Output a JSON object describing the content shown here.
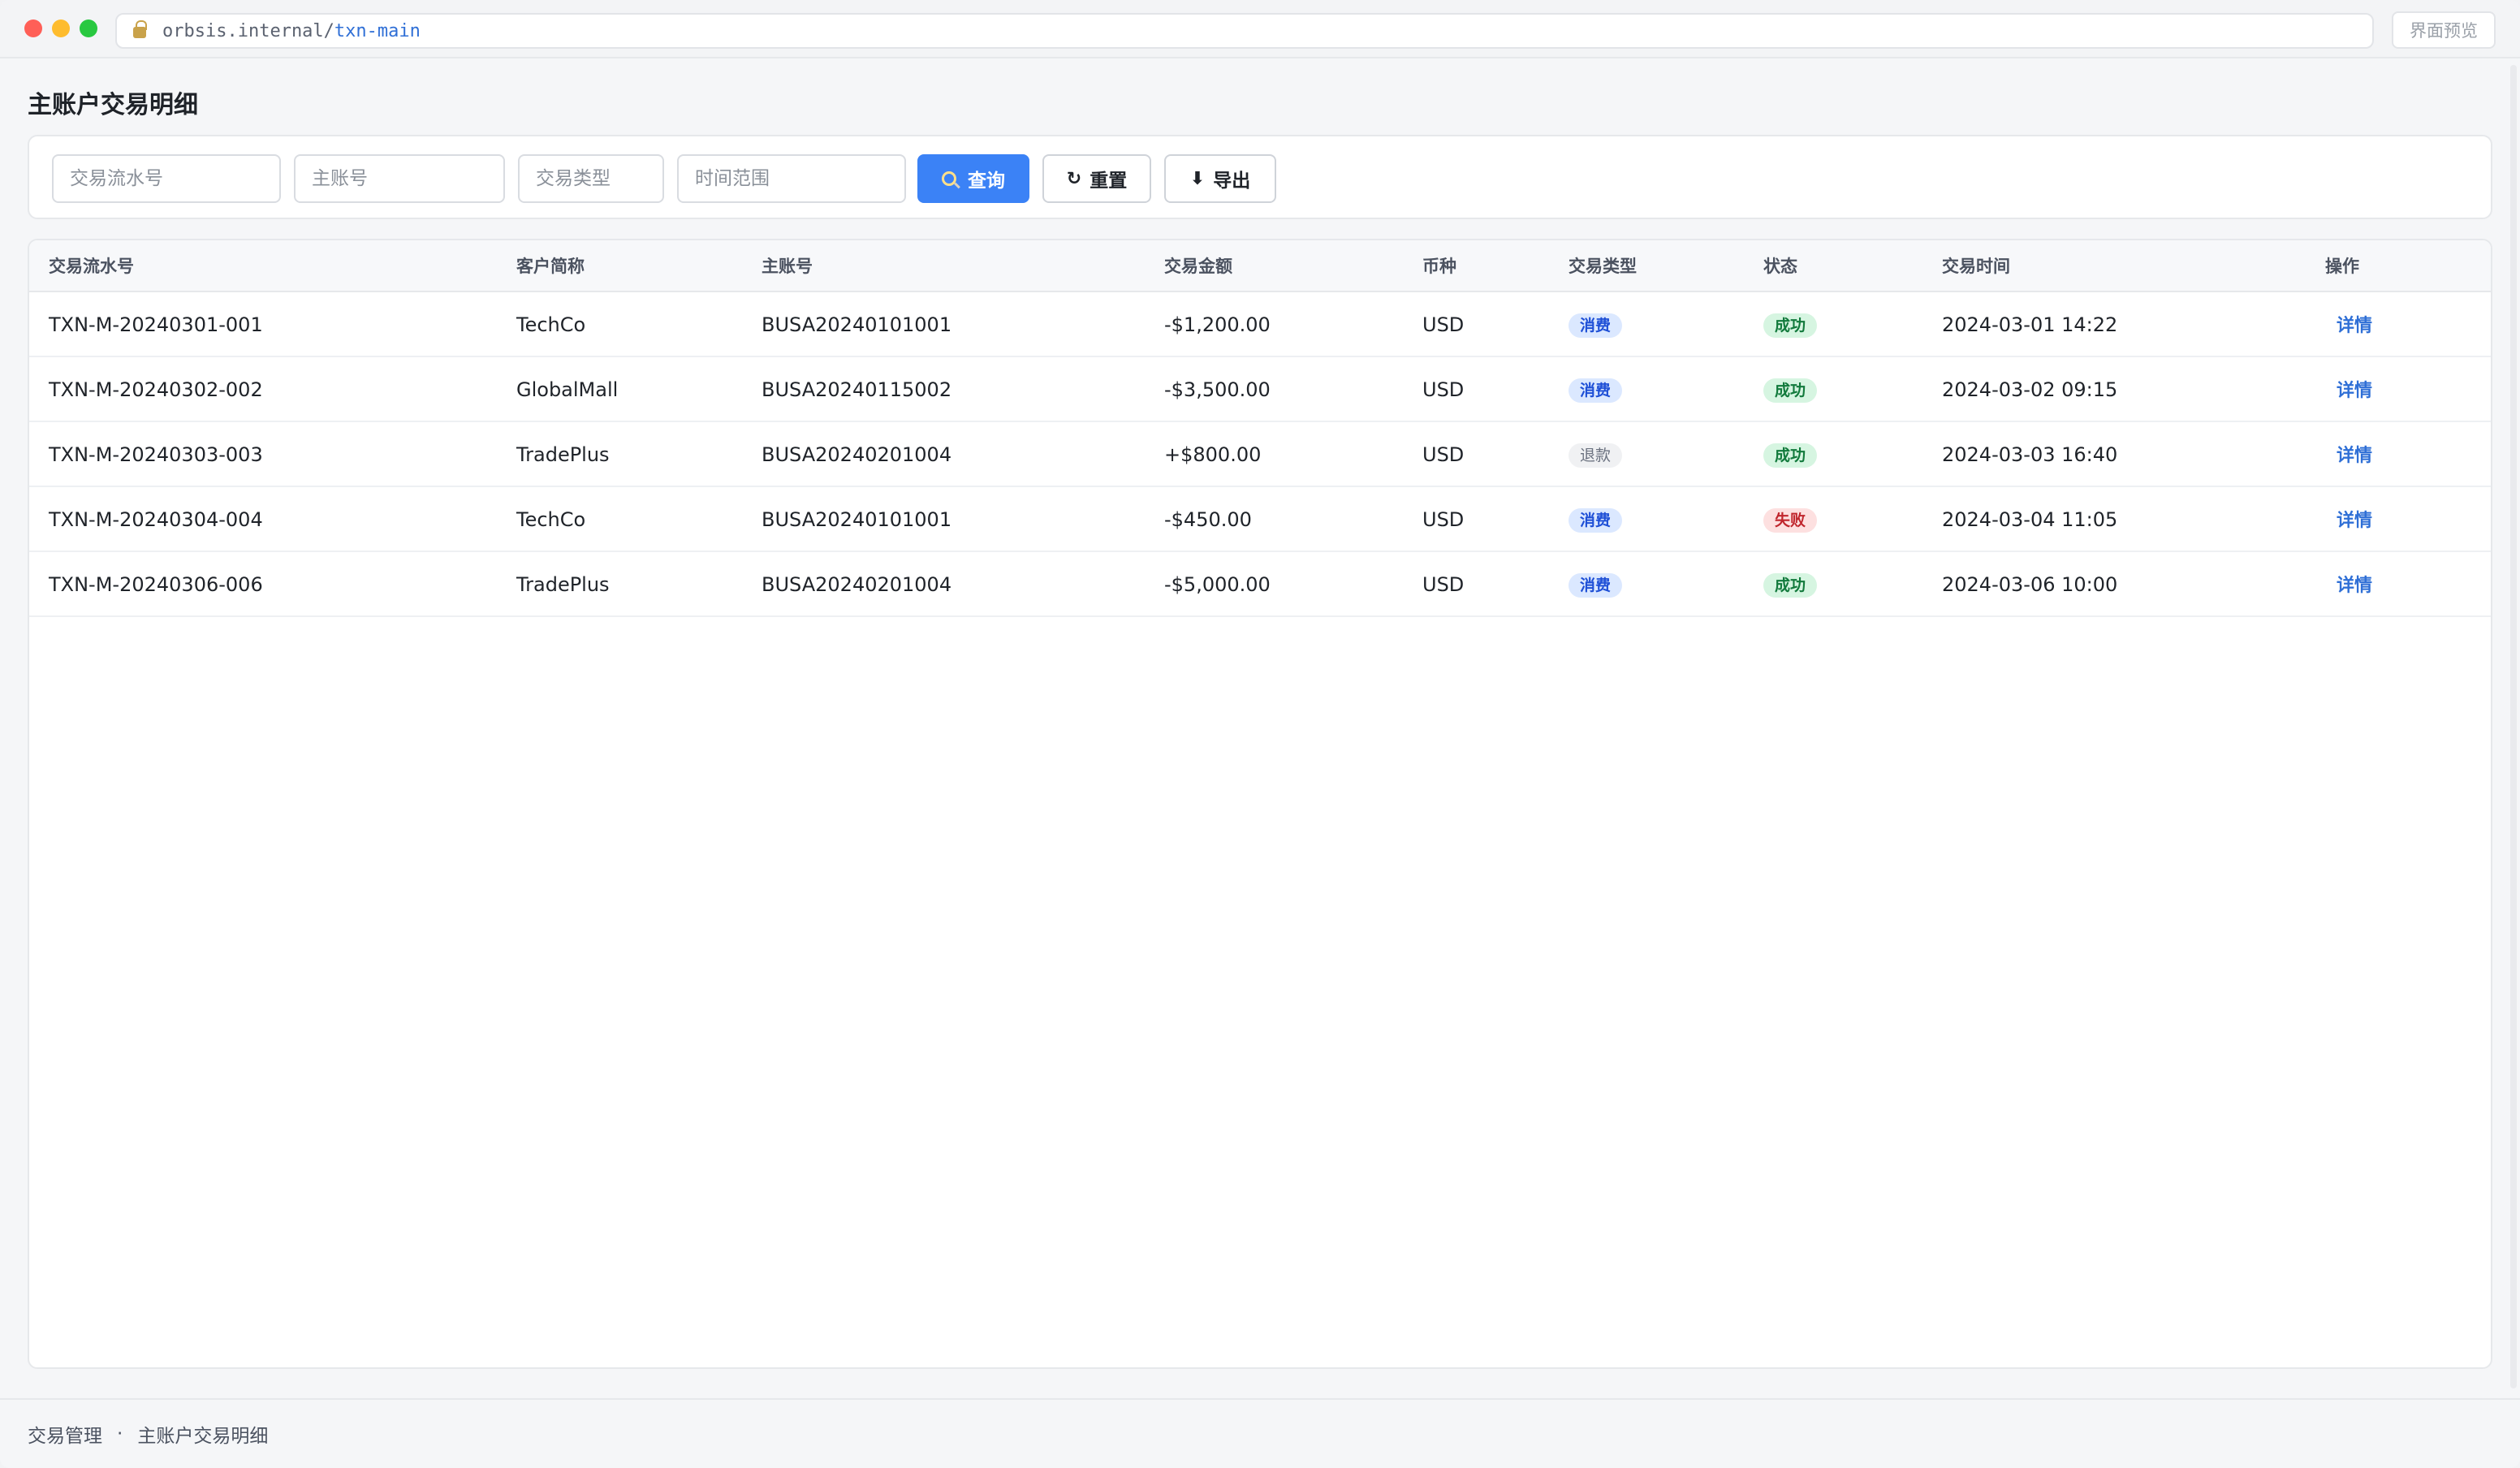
{
  "browser": {
    "url_host": "orbsis.internal/",
    "url_path": "txn-main",
    "preview_label": "界面预览"
  },
  "page": {
    "title": "主账户交易明细"
  },
  "filters": {
    "txn_id_placeholder": "交易流水号",
    "account_placeholder": "主账号",
    "type_placeholder": "交易类型",
    "time_placeholder": "时间范围",
    "search_label": "查询",
    "reset_label": "重置",
    "export_label": "导出"
  },
  "table": {
    "columns": [
      "交易流水号",
      "客户简称",
      "主账号",
      "交易金额",
      "币种",
      "交易类型",
      "状态",
      "交易时间",
      "操作"
    ],
    "rows": [
      {
        "txn_id": "TXN-M-20240301-001",
        "customer": "TechCo",
        "account": "BUSA20240101001",
        "amount": "-$1,200.00",
        "currency": "USD",
        "type": "消费",
        "type_style": "blue",
        "status": "成功",
        "status_style": "green",
        "time": "2024-03-01 14:22",
        "action": "详情"
      },
      {
        "txn_id": "TXN-M-20240302-002",
        "customer": "GlobalMall",
        "account": "BUSA20240115002",
        "amount": "-$3,500.00",
        "currency": "USD",
        "type": "消费",
        "type_style": "blue",
        "status": "成功",
        "status_style": "green",
        "time": "2024-03-02 09:15",
        "action": "详情"
      },
      {
        "txn_id": "TXN-M-20240303-003",
        "customer": "TradePlus",
        "account": "BUSA20240201004",
        "amount": "+$800.00",
        "currency": "USD",
        "type": "退款",
        "type_style": "gray",
        "status": "成功",
        "status_style": "green",
        "time": "2024-03-03 16:40",
        "action": "详情"
      },
      {
        "txn_id": "TXN-M-20240304-004",
        "customer": "TechCo",
        "account": "BUSA20240101001",
        "amount": "-$450.00",
        "currency": "USD",
        "type": "消费",
        "type_style": "blue",
        "status": "失败",
        "status_style": "red",
        "time": "2024-03-04 11:05",
        "action": "详情"
      },
      {
        "txn_id": "TXN-M-20240306-006",
        "customer": "TradePlus",
        "account": "BUSA20240201004",
        "amount": "-$5,000.00",
        "currency": "USD",
        "type": "消费",
        "type_style": "blue",
        "status": "成功",
        "status_style": "green",
        "time": "2024-03-06 10:00",
        "action": "详情"
      }
    ]
  },
  "footer": {
    "section": "交易管理",
    "separator": "·",
    "page": "主账户交易明细"
  },
  "colors": {
    "primary": "#3b82f6",
    "success": "#127a3c",
    "danger": "#c0262d",
    "link": "#2f6fd6"
  }
}
